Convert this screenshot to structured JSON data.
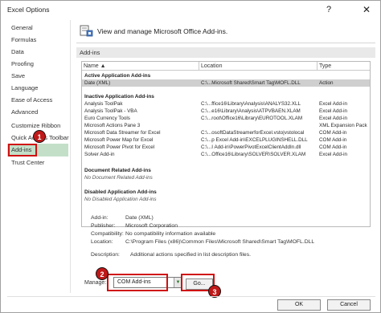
{
  "window": {
    "title": "Excel Options",
    "help_glyph": "?",
    "close_glyph": "✕"
  },
  "sidebar": {
    "items": [
      {
        "label": "General"
      },
      {
        "label": "Formulas"
      },
      {
        "label": "Data"
      },
      {
        "label": "Proofing"
      },
      {
        "label": "Save"
      },
      {
        "label": "Language"
      },
      {
        "label": "Ease of Access"
      },
      {
        "label": "Advanced"
      },
      {
        "label": "Customize Ribbon"
      },
      {
        "label": "Quick Access Toolbar"
      },
      {
        "label": "Add-ins",
        "selected": true
      },
      {
        "label": "Trust Center"
      }
    ]
  },
  "main": {
    "header": "View and manage Microsoft Office Add-ins.",
    "section": "Add-ins",
    "columns": [
      "Name ▲",
      "Location",
      "Type"
    ],
    "active_group": "Active Application Add-ins",
    "active_rows": [
      {
        "name": "Date (XML)",
        "location": "C:\\...Microsoft Shared\\Smart Tag\\MOFL.DLL",
        "type": "Action"
      }
    ],
    "inactive_group": "Inactive Application Add-ins",
    "inactive_rows": [
      {
        "name": "Analysis ToolPak",
        "location": "C:\\...ffice16\\Library\\Analysis\\ANALYS32.XLL",
        "type": "Excel Add-in"
      },
      {
        "name": "Analysis ToolPak - VBA",
        "location": "C:\\...e16\\Library\\Analysis\\ATPVBAEN.XLAM",
        "type": "Excel Add-in"
      },
      {
        "name": "Euro Currency Tools",
        "location": "C:\\...root\\Office16\\Library\\EUROTOOL.XLAM",
        "type": "Excel Add-in"
      },
      {
        "name": "Microsoft Actions Pane 3",
        "location": "",
        "type": "XML Expansion Pack"
      },
      {
        "name": "Microsoft Data Streamer for Excel",
        "location": "C:\\...osoftDataStreamerforExcel.vsto|vstolocal",
        "type": "COM Add-in"
      },
      {
        "name": "Microsoft Power Map for Excel",
        "location": "C:\\...p Excel Add-in\\EXCELPLUGINSHELL.DLL",
        "type": "COM Add-in"
      },
      {
        "name": "Microsoft Power Pivot for Excel",
        "location": "C:\\...I Add-in\\PowerPivotExcelClientAddIn.dll",
        "type": "COM Add-in"
      },
      {
        "name": "Solver Add-in",
        "location": "C:\\...Office16\\Library\\SOLVER\\SOLVER.XLAM",
        "type": "Excel Add-in"
      }
    ],
    "document_group": "Document Related Add-ins",
    "document_empty": "No Document Related Add-ins",
    "disabled_group": "Disabled Application Add-ins",
    "disabled_empty": "No Disabled Application Add-ins",
    "details": [
      {
        "key": "Add-in:",
        "value": "Date (XML)"
      },
      {
        "key": "Publisher:",
        "value": "Microsoft Corporation"
      },
      {
        "key": "Compatibility:",
        "value": "No compatibility information available"
      },
      {
        "key": "Location:",
        "value": "C:\\Program Files (x86)\\Common Files\\Microsoft Shared\\Smart Tag\\MOFL.DLL"
      },
      {
        "key": "Description:",
        "value": "Additional actions specified in list description files."
      }
    ],
    "manage_label": "Manage:",
    "manage_value": "COM Add-ins",
    "go_label": "Go..."
  },
  "footer": {
    "ok": "OK",
    "cancel": "Cancel"
  },
  "badges": [
    "1",
    "2",
    "3"
  ],
  "colors": {
    "highlight": "#d01010",
    "selected_nav": "#c3dfc8"
  }
}
